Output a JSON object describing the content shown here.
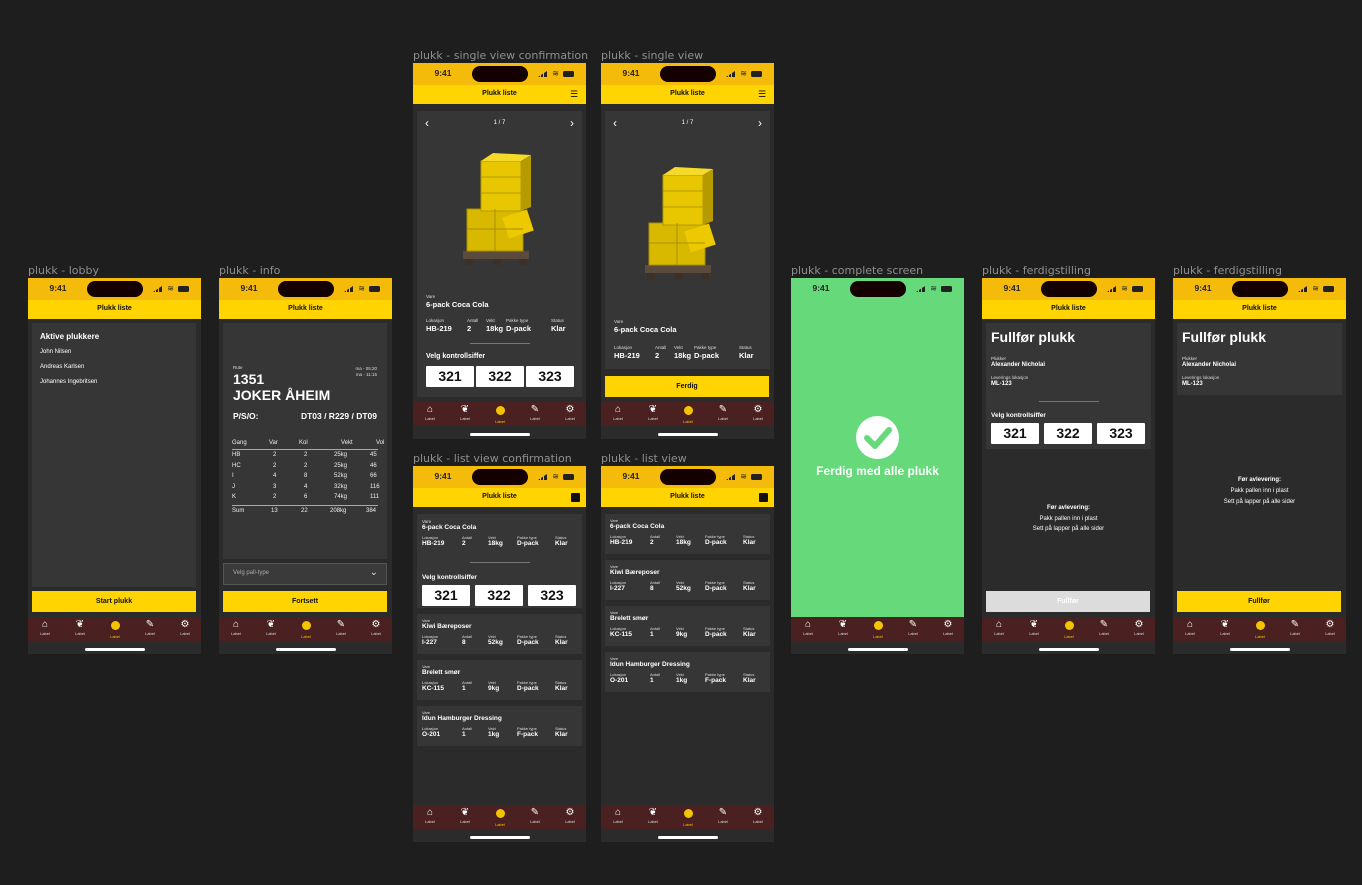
{
  "frames": {
    "lobby": "plukk - lobby",
    "info": "plukk - info",
    "single_conf": "plukk - single view confirmation",
    "single": "plukk - single view",
    "list_conf": "plukk - list view confirmation",
    "list": "plukk - list view",
    "complete": "plukk - complete screen",
    "ferdig1": "plukk - ferdigstilling",
    "ferdig2": "plukk - ferdigstilling"
  },
  "status_time": "9:41",
  "header_title": "Plukk liste",
  "tab_label": "Label",
  "lobby": {
    "heading": "Aktive plukkere",
    "pickers": [
      "John Nilsen",
      "Andreas Karlsen",
      "Johannes Ingebritsen"
    ],
    "button": "Start plukk"
  },
  "info": {
    "rute_label": "Rute",
    "rute": "1351",
    "name": "JOKER ÅHEIM",
    "time1": "ma - 05:20",
    "time2": "ma - 11:15",
    "pso_label": "P/S/O:",
    "pso": "DT03 / R229 / DT09",
    "headers": [
      "Gang",
      "Var",
      "Kol",
      "Vekt",
      "Vol"
    ],
    "rows": [
      [
        "HB",
        "2",
        "2",
        "25kg",
        "45"
      ],
      [
        "HC",
        "2",
        "2",
        "25kg",
        "46"
      ],
      [
        "I",
        "4",
        "8",
        "52kg",
        "66"
      ],
      [
        "J",
        "3",
        "4",
        "32kg",
        "116"
      ],
      [
        "K",
        "2",
        "6",
        "74kg",
        "111"
      ]
    ],
    "sum": [
      "Sum",
      "13",
      "22",
      "208kg",
      "384"
    ],
    "select_placeholder": "Velg pall-type",
    "button": "Fortsett"
  },
  "single": {
    "pager": "1 / 7",
    "vare_label": "Vare",
    "vare": "6-pack Coca Cola",
    "fields": [
      {
        "l": "Lokasjon",
        "v": "HB-219"
      },
      {
        "l": "Antall",
        "v": "2"
      },
      {
        "l": "Vekt",
        "v": "18kg"
      },
      {
        "l": "Pakke type",
        "v": "D-pack"
      },
      {
        "l": "Status",
        "v": "Klar"
      }
    ],
    "velg": "Velg kontrollsiffer",
    "codes": [
      "321",
      "322",
      "323"
    ],
    "button": "Ferdig"
  },
  "list": {
    "labels": [
      "Vare",
      "Lokasjon",
      "Antall",
      "Vekt",
      "Pakke type",
      "Status"
    ],
    "items": [
      {
        "name": "6-pack Coca Cola",
        "vals": [
          "HB-219",
          "2",
          "18kg",
          "D-pack",
          "Klar"
        ]
      },
      {
        "name": "Kiwi Bæreposer",
        "vals": [
          "I-227",
          "8",
          "52kg",
          "D-pack",
          "Klar"
        ]
      },
      {
        "name": "Brelett smør",
        "vals": [
          "KC-115",
          "1",
          "9kg",
          "D-pack",
          "Klar"
        ]
      },
      {
        "name": "Idun Hamburger Dressing",
        "vals": [
          "O-201",
          "1",
          "1kg",
          "F-pack",
          "Klar"
        ]
      }
    ]
  },
  "complete": {
    "message": "Ferdig med alle plukk"
  },
  "ferdig": {
    "title": "Fullfør plukk",
    "plukker_label": "Plukker",
    "plukker": "Alexander Nicholai",
    "lev_label": "Leverings lokasjon",
    "lev": "ML-123",
    "instr_title": "Før avlevering:",
    "instr1": "Pakk pallen inn i plast",
    "instr2": "Sett på lapper på alle sider",
    "button": "Fullfør"
  },
  "colors": {
    "accent": "#ffd400",
    "status_bar": "#f5bb0a",
    "tabbar": "#4a2020",
    "success": "#66d97a"
  },
  "icons": [
    "home-icon",
    "leaf-icon",
    "user-icon",
    "pen-icon",
    "gear-icon",
    "check-icon",
    "chevron-left-icon",
    "chevron-right-icon",
    "chevron-down-icon",
    "list-icon"
  ]
}
